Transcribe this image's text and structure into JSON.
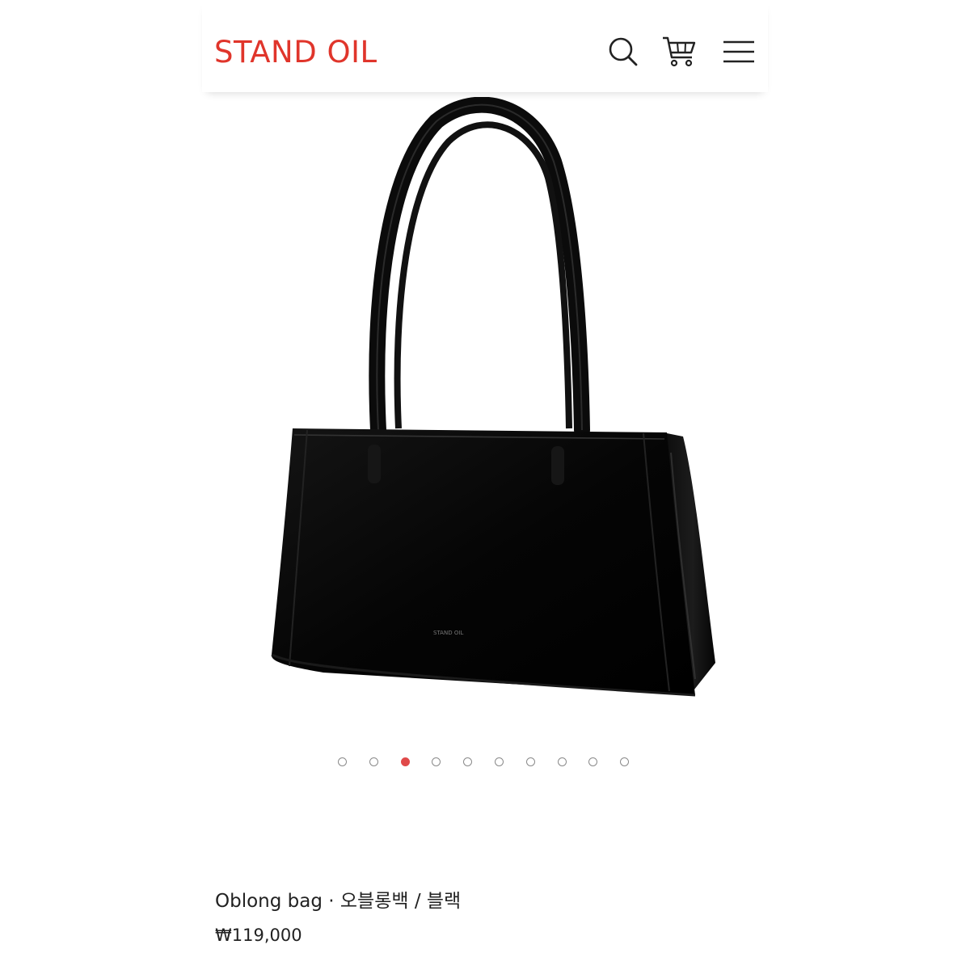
{
  "header": {
    "logo_text": "STAND OIL",
    "brand_color": "#e0352b",
    "icons": [
      "search-icon",
      "cart-icon",
      "menu-icon"
    ]
  },
  "product": {
    "image_alt": "Oblong bag black leather shoulder bag",
    "image_stamp": "STAND OIL",
    "name": "Oblong bag · 오블롱백 / 블랙",
    "price": "₩119,000"
  },
  "carousel": {
    "total": 10,
    "active_index": 2,
    "active_color": "#e04a4a"
  }
}
